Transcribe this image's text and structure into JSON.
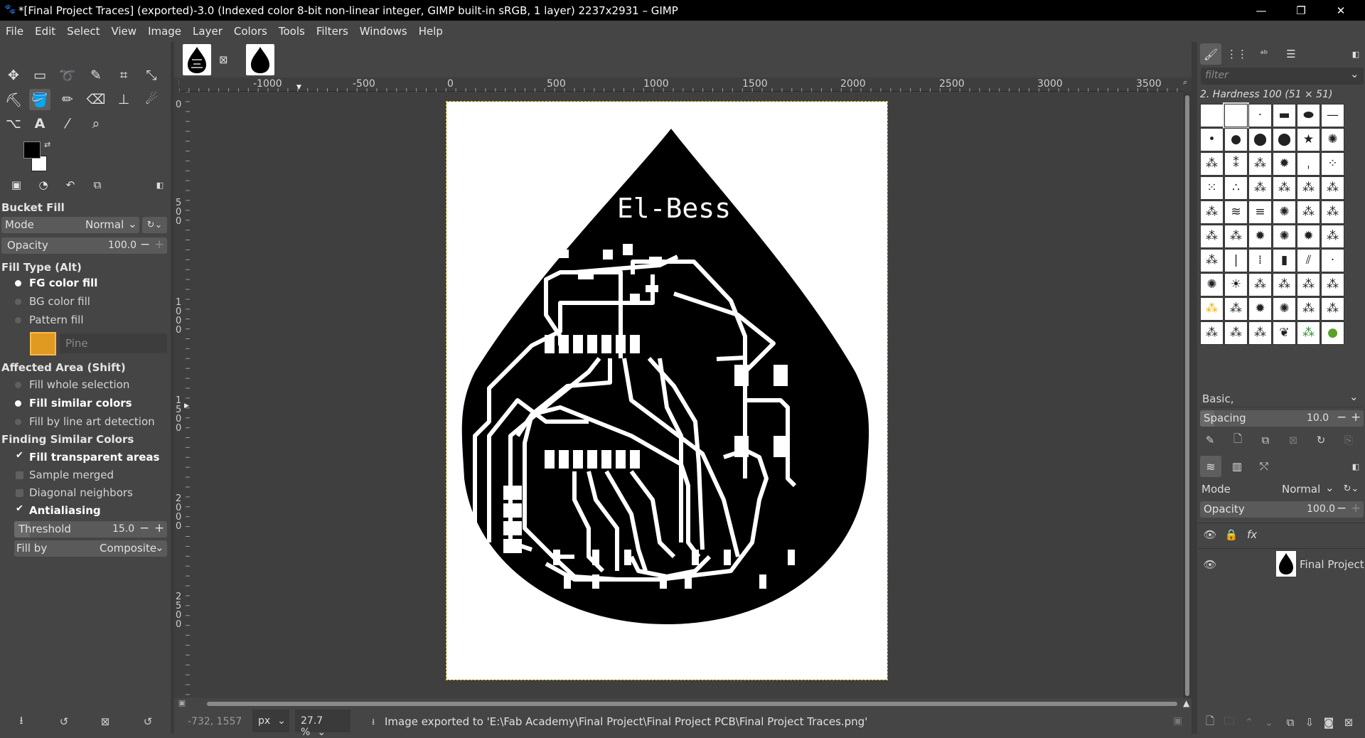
{
  "window": {
    "title": "*[Final Project Traces] (exported)-3.0 (Indexed color 8-bit non-linear integer, GIMP built-in sRGB, 1 layer) 2237x2931 – GIMP",
    "minimize": "—",
    "maximize": "❐",
    "close": "✕"
  },
  "menu": [
    "File",
    "Edit",
    "Select",
    "View",
    "Image",
    "Layer",
    "Colors",
    "Tools",
    "Filters",
    "Windows",
    "Help"
  ],
  "tool_options": {
    "tool_name": "Bucket Fill",
    "mode_label": "Mode",
    "mode_value": "Normal",
    "opacity_label": "Opacity",
    "opacity_value": "100.0",
    "fill_type_label": "Fill Type  (Alt)",
    "fill_fg": "FG color fill",
    "fill_bg": "BG color fill",
    "fill_pattern": "Pattern fill",
    "pattern_name": "Pine",
    "affected_label": "Affected Area  (Shift)",
    "area_whole": "Fill whole selection",
    "area_similar": "Fill similar colors",
    "area_lineart": "Fill by line art detection",
    "finding_label": "Finding Similar Colors",
    "fill_transparent": "Fill transparent areas",
    "sample_merged": "Sample merged",
    "diagonal": "Diagonal neighbors",
    "antialiasing": "Antialiasing",
    "threshold_label": "Threshold",
    "threshold_value": "15.0",
    "fillby_label": "Fill by",
    "fillby_value": "Composite"
  },
  "ruler_top": [
    "-1000",
    "-500",
    "0",
    "500",
    "1000",
    "1500",
    "2000",
    "2500",
    "3000",
    "3500"
  ],
  "ruler_left": [
    "0",
    "500",
    "1000",
    "1500",
    "2000",
    "2500"
  ],
  "canvas_text": "El-Bess",
  "status": {
    "coords": "-732, 1557",
    "unit": "px",
    "zoom": "27.7 %",
    "message": "Image exported to 'E:\\Fab Academy\\Final Project\\Final Project PCB\\Final Project Traces.png'"
  },
  "brushes": {
    "filter_placeholder": "filter",
    "current": "2. Hardness 100 (51 × 51)",
    "preset": "Basic,",
    "spacing_label": "Spacing",
    "spacing_value": "10.0"
  },
  "layers": {
    "mode_label": "Mode",
    "mode_value": "Normal",
    "opacity_label": "Opacity",
    "opacity_value": "100.0",
    "fx": "fx",
    "layer_name": "Final Project T"
  }
}
